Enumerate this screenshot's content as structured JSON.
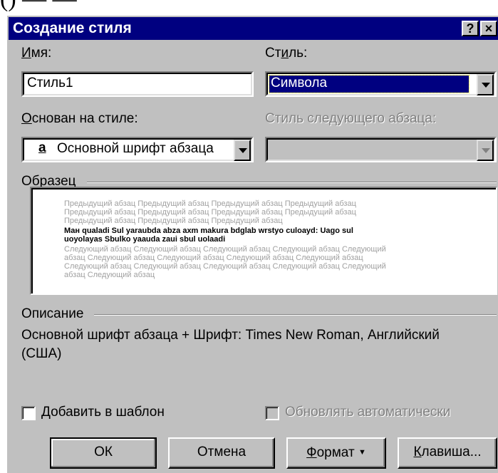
{
  "page_caption_fragment": "(                   )  ̶  ̶  ̶  ̶  ̶  ̶  ̶  ̶  ̶",
  "window": {
    "title": "Создание стиля",
    "help_button": "?",
    "close_button": "×"
  },
  "name": {
    "label_u": "И",
    "label_rest": "мя:",
    "value": "Стиль1"
  },
  "style_type": {
    "label_pre": "Ст",
    "label_u": "и",
    "label_rest": "ль:",
    "value": "Символа"
  },
  "based_on": {
    "label_u": "О",
    "label_rest": "снован на стиле:",
    "icon_glyph": "a",
    "value": "Основной шрифт абзаца"
  },
  "next_style": {
    "label": "Стиль следующего абзаца:",
    "value": ""
  },
  "preview": {
    "label": "Образец",
    "before_lines": [
      "Предыдущий абзац Предыдущий абзац Предыдущий абзац Предыдущий абзац",
      "Предыдущий абзац Предыдущий абзац Предыдущий абзац Предыдущий абзац",
      "Предыдущий абзац Предыдущий абзац Предыдущий абзац"
    ],
    "sample_lines": [
      "Ман qualadi Sul yaraubda abza axm makura bdglab wrstyo culoayd: Uago sul",
      "uoyolayas Sbulko yaauda zaui sbul uolaadi"
    ],
    "after_lines": [
      "Следующий абзац Следующий абзац Следующий абзац Следующий абзац Следующий",
      "абзац Следующий абзац Следующий абзац Следующий абзац Следующий абзац",
      "Следующий абзац Следующий абзац Следующий абзац Следующий абзац Следующий",
      "абзац Следующий абзац"
    ]
  },
  "description": {
    "label": "Описание",
    "line1": "Основной шрифт абзаца + Шрифт: Times New Roman, Английский",
    "line2": "(США)"
  },
  "checkboxes": {
    "add_to_template_u": "Д",
    "add_to_template_rest": "обавить в шаблон",
    "add_to_template_checked": false,
    "auto_update_label": "Обновлять автоматически",
    "auto_update_checked": false,
    "auto_update_enabled": false
  },
  "buttons": {
    "ok": "ОК",
    "cancel": "Отмена",
    "format_u": "Ф",
    "format_rest": "ормат",
    "format_arrow": "▼",
    "keys_u": "К",
    "keys_rest": "лавиша..."
  },
  "colors": {
    "titlebar": "#000080",
    "face": "#c0c0c0",
    "selection": "#000080"
  }
}
